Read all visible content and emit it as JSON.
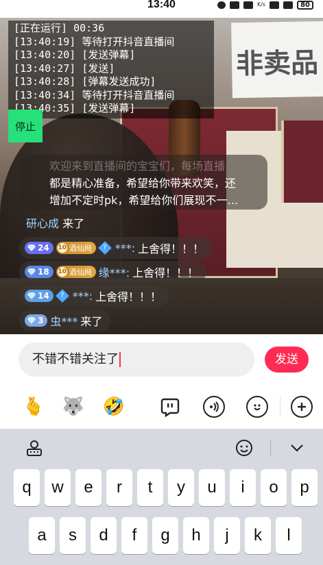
{
  "status_bar": {
    "time": "13:40",
    "net_speed": "K/s",
    "battery": "80"
  },
  "log": {
    "lines": [
      "[正在运行] 00:36",
      "[13:40:19] 等待打开抖音直播间",
      "[13:40:20] [发送弹幕]",
      "[13:40:27] [发送]",
      "[13:40:28] [弹幕发送成功]",
      "[13:40:34] 等待打开抖音直播间",
      "[13:40:35] [发送弹幕]"
    ],
    "stop_label": "停止"
  },
  "scene": {
    "sign_text": "非卖品"
  },
  "announcement": {
    "line1": "欢迎来到直播间的宝宝们，每场直播",
    "line2": "都是精心准备，希望给你带来欢笑，还",
    "line3": "增加不定时pk，希望给你们展现不一…"
  },
  "welcome": {
    "name": "研心成",
    "text": "来了"
  },
  "comments": [
    {
      "level": "24",
      "fan_club": "酒仙网",
      "fan_level": "10",
      "user": "***:",
      "message": "上舍得！！！"
    },
    {
      "level": "18",
      "fan_club": "酒仙网",
      "fan_level": "10",
      "user": "缘***:",
      "message": "上舍得！！！"
    },
    {
      "level": "14",
      "user": "***:",
      "message": "上舍得！！！"
    },
    {
      "level": "3",
      "user": "虫***",
      "message": "来了"
    }
  ],
  "input": {
    "value": "不错不错关注了",
    "send_label": "发送"
  },
  "toolbar": {
    "icons": [
      "finger-heart-emoji",
      "husky-emoji",
      "laughing-emoji",
      "quick-reply-icon",
      "voice-icon",
      "emoji-face-icon",
      "plus-icon"
    ]
  },
  "keyboard": {
    "row1": [
      "q",
      "w",
      "e",
      "r",
      "t",
      "y",
      "u",
      "i",
      "o",
      "p"
    ],
    "row2": [
      "a",
      "s",
      "d",
      "f",
      "g",
      "h",
      "j",
      "k",
      "l"
    ]
  }
}
